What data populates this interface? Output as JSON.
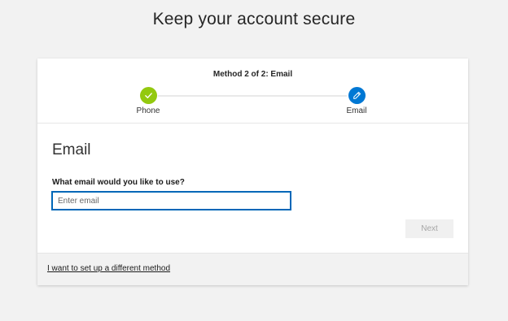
{
  "page": {
    "title": "Keep your account secure"
  },
  "progress": {
    "label": "Method 2 of 2: Email",
    "steps": [
      {
        "label": "Phone",
        "status": "completed",
        "icon": "checkmark-icon"
      },
      {
        "label": "Email",
        "status": "current",
        "icon": "pencil-icon"
      }
    ]
  },
  "form": {
    "heading": "Email",
    "field_label": "What email would you like to use?",
    "email_value": "",
    "email_placeholder": "Enter email",
    "next_label": "Next"
  },
  "footer": {
    "link_label": "I want to set up a different method"
  },
  "colors": {
    "completed_step": "#93c90f",
    "current_step": "#0078d4",
    "input_border": "#0067b8",
    "disabled_button_bg": "#f0f0f0",
    "disabled_button_text": "#a6a6a6"
  }
}
